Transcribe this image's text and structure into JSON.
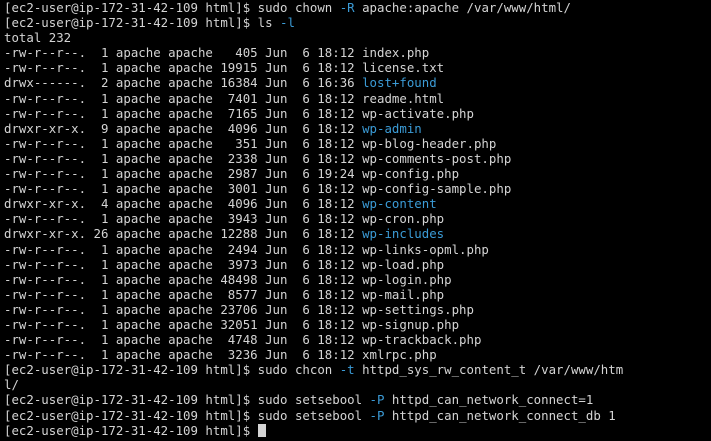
{
  "colors": {
    "background": "#000000",
    "text": "#d4d4d4",
    "directory": "#3b9bd6",
    "flag": "#3b9bd6"
  },
  "prompt": "[ec2-user@ip-172-31-42-109 html]$ ",
  "commands": {
    "chown": {
      "cmd": "sudo chown ",
      "flag": "-R",
      "args": " apache:apache /var/www/html/"
    },
    "ls": {
      "cmd": "ls ",
      "flag": "-l"
    },
    "chcon": {
      "cmd": "sudo chcon ",
      "flag": "-t",
      "args": " httpd_sys_rw_content_t /var/www/htm",
      "wrap": "l/"
    },
    "setsebool1": {
      "cmd": "sudo setsebool ",
      "flag": "-P",
      "args": " httpd_can_network_connect=1"
    },
    "setsebool2": {
      "cmd": "sudo setsebool ",
      "flag": "-P",
      "args": " httpd_can_network_connect_db 1"
    }
  },
  "total": "total 232",
  "listing": [
    {
      "meta": "-rw-r--r--.  1 apache apache   405 Jun  6 18:12 ",
      "name": "index.php",
      "dir": false
    },
    {
      "meta": "-rw-r--r--.  1 apache apache 19915 Jun  6 18:12 ",
      "name": "license.txt",
      "dir": false
    },
    {
      "meta": "drwx------.  2 apache apache 16384 Jun  6 16:36 ",
      "name": "lost+found",
      "dir": true
    },
    {
      "meta": "-rw-r--r--.  1 apache apache  7401 Jun  6 18:12 ",
      "name": "readme.html",
      "dir": false
    },
    {
      "meta": "-rw-r--r--.  1 apache apache  7165 Jun  6 18:12 ",
      "name": "wp-activate.php",
      "dir": false
    },
    {
      "meta": "drwxr-xr-x.  9 apache apache  4096 Jun  6 18:12 ",
      "name": "wp-admin",
      "dir": true
    },
    {
      "meta": "-rw-r--r--.  1 apache apache   351 Jun  6 18:12 ",
      "name": "wp-blog-header.php",
      "dir": false
    },
    {
      "meta": "-rw-r--r--.  1 apache apache  2338 Jun  6 18:12 ",
      "name": "wp-comments-post.php",
      "dir": false
    },
    {
      "meta": "-rw-r--r--.  1 apache apache  2987 Jun  6 19:24 ",
      "name": "wp-config.php",
      "dir": false
    },
    {
      "meta": "-rw-r--r--.  1 apache apache  3001 Jun  6 18:12 ",
      "name": "wp-config-sample.php",
      "dir": false
    },
    {
      "meta": "drwxr-xr-x.  4 apache apache  4096 Jun  6 18:12 ",
      "name": "wp-content",
      "dir": true
    },
    {
      "meta": "-rw-r--r--.  1 apache apache  3943 Jun  6 18:12 ",
      "name": "wp-cron.php",
      "dir": false
    },
    {
      "meta": "drwxr-xr-x. 26 apache apache 12288 Jun  6 18:12 ",
      "name": "wp-includes",
      "dir": true
    },
    {
      "meta": "-rw-r--r--.  1 apache apache  2494 Jun  6 18:12 ",
      "name": "wp-links-opml.php",
      "dir": false
    },
    {
      "meta": "-rw-r--r--.  1 apache apache  3973 Jun  6 18:12 ",
      "name": "wp-load.php",
      "dir": false
    },
    {
      "meta": "-rw-r--r--.  1 apache apache 48498 Jun  6 18:12 ",
      "name": "wp-login.php",
      "dir": false
    },
    {
      "meta": "-rw-r--r--.  1 apache apache  8577 Jun  6 18:12 ",
      "name": "wp-mail.php",
      "dir": false
    },
    {
      "meta": "-rw-r--r--.  1 apache apache 23706 Jun  6 18:12 ",
      "name": "wp-settings.php",
      "dir": false
    },
    {
      "meta": "-rw-r--r--.  1 apache apache 32051 Jun  6 18:12 ",
      "name": "wp-signup.php",
      "dir": false
    },
    {
      "meta": "-rw-r--r--.  1 apache apache  4748 Jun  6 18:12 ",
      "name": "wp-trackback.php",
      "dir": false
    },
    {
      "meta": "-rw-r--r--.  1 apache apache  3236 Jun  6 18:12 ",
      "name": "xmlrpc.php",
      "dir": false
    }
  ]
}
